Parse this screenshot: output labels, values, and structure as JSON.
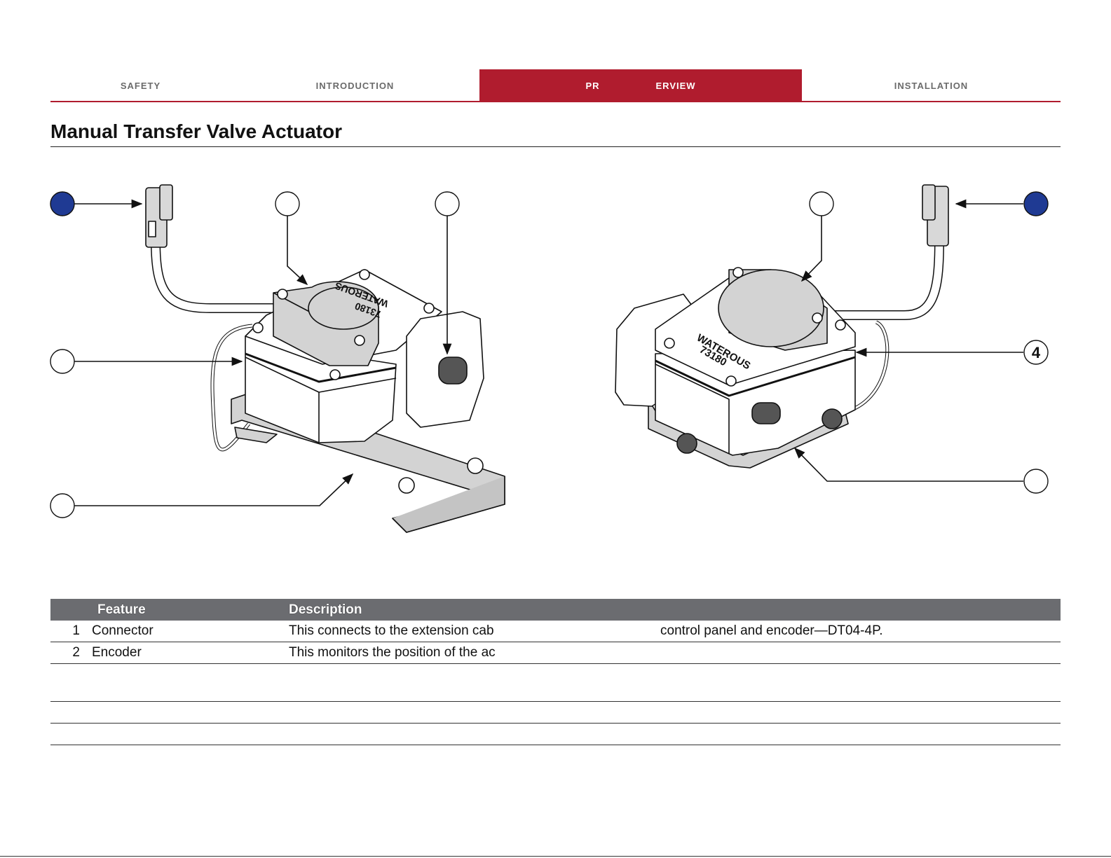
{
  "nav": {
    "tabs": [
      {
        "label": "Safety",
        "active": false
      },
      {
        "label": "Introduction",
        "active": false
      },
      {
        "label_start": "Pr",
        "label_end": "erview",
        "active": true
      },
      {
        "label": "Installation",
        "active": false
      }
    ]
  },
  "page": {
    "title": "Manual Transfer Valve Actuator"
  },
  "figure": {
    "product_marking_line1": "WATEROUS",
    "product_marking_line2": "73180",
    "visible_callout": "4",
    "colors": {
      "callout_filled": "#1f3a93",
      "housing_fill": "#d3d3d3",
      "outline": "#111111"
    }
  },
  "table": {
    "headers": [
      "",
      "Feature",
      "Description",
      ""
    ],
    "rows": [
      {
        "num": "1",
        "feature": "Connector",
        "desc_a": "This connects to the extension cab",
        "desc_b": "control panel and encoder—DT04-4P."
      },
      {
        "num": "2",
        "feature": "Encoder",
        "desc_a": "This monitors the position of the ac",
        "desc_b": ""
      }
    ],
    "empty_rows": 3
  },
  "colors": {
    "brand_red": "#b01c2e",
    "header_gray": "#6b6c70",
    "tab_text": "#6b6b6b"
  }
}
